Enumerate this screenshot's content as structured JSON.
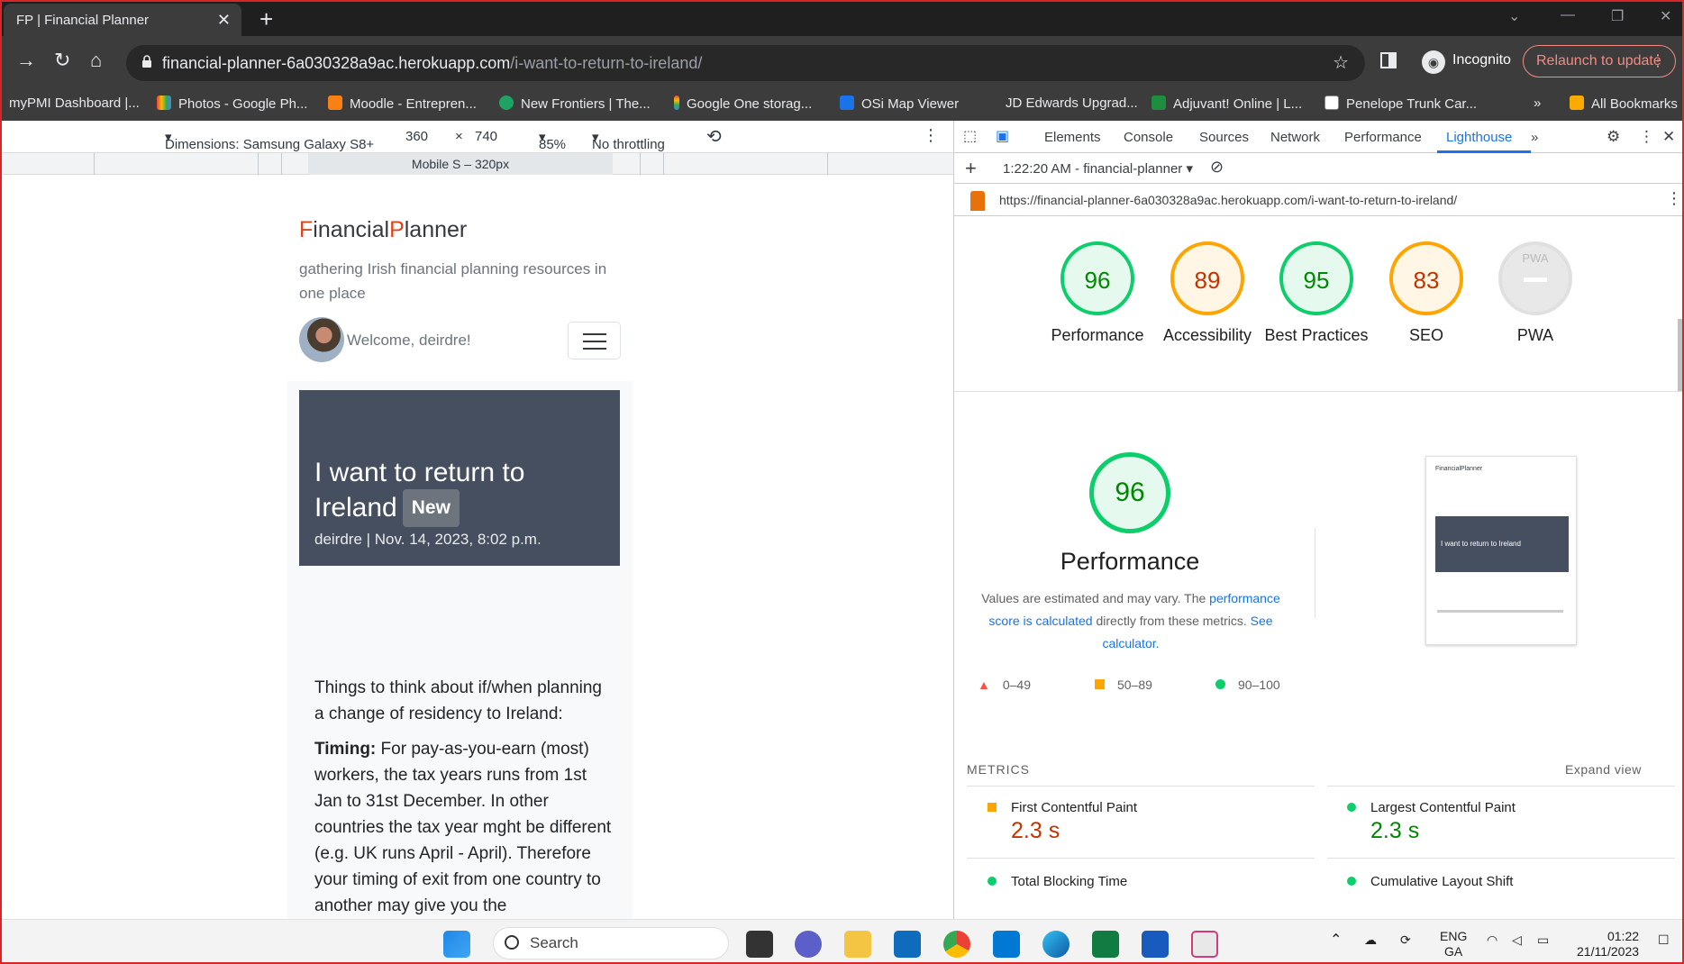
{
  "browser": {
    "tab_title": "FP | Financial Planner",
    "url_host": "financial-planner-6a030328a9ac.herokuapp.com",
    "url_path": "/i-want-to-return-to-ireland/",
    "incognito_label": "Incognito",
    "relaunch_label": "Relaunch to update",
    "bookmarks": [
      "myPMI Dashboard |...",
      "Photos - Google Ph...",
      "Moodle - Entrepren...",
      "New Frontiers | The...",
      "Google One storag...",
      "OSi Map Viewer",
      "JD Edwards Upgrad...",
      "Adjuvant! Online | L...",
      "Penelope Trunk Car..."
    ],
    "all_bookmarks": "All Bookmarks",
    "more_bookmarks": "»"
  },
  "device_toolbar": {
    "dimensions": "Dimensions: Samsung Galaxy S8+",
    "width": "360",
    "times": "×",
    "height": "740",
    "zoom": "85%",
    "throttle": "No throttling",
    "media_query": "Mobile S – 320px"
  },
  "site": {
    "brand_f": "F",
    "brand_inancial": "inancial",
    "brand_p": "P",
    "brand_lanner": "lanner",
    "tagline": "gathering Irish financial planning resources in one place",
    "welcome": "Welcome, deirdre!",
    "post_title": "I want to return to Ireland",
    "badge": "New",
    "post_meta": "deirdre | Nov. 14, 2023, 8:02 p.m.",
    "para1": "Things to think about if/when planning a change of residency to Ireland:",
    "para2_bold": "Timing:",
    "para2": " For pay-as-you-earn (most) workers, the tax years runs from 1st Jan to 31st December.  In other countries the tax year mght be different (e.g. UK runs April - April). Therefore your timing of exit from one country to another may give you the"
  },
  "devtools": {
    "tabs": [
      "Elements",
      "Console",
      "Sources",
      "Network",
      "Performance",
      "Lighthouse"
    ],
    "more_tabs": "»",
    "report_time": "1:22:20 AM - financial-planner",
    "report_url": "https://financial-planner-6a030328a9ac.herokuapp.com/i-want-to-return-to-ireland/",
    "scores": [
      {
        "value": "96",
        "label": "Performance",
        "status": "green"
      },
      {
        "value": "89",
        "label": "Accessibility",
        "status": "orange"
      },
      {
        "value": "95",
        "label": "Best Practices",
        "status": "green"
      },
      {
        "value": "83",
        "label": "SEO",
        "status": "orange"
      },
      {
        "value": "PWA",
        "label": "PWA",
        "status": "grey"
      }
    ],
    "perf_score": "96",
    "perf_title": "Performance",
    "desc_prefix": "Values are estimated and may vary. The ",
    "desc_link1": "performance score is calculated",
    "desc_mid": " directly from these metrics. ",
    "desc_link2": "See calculator.",
    "legend": [
      "0–49",
      "50–89",
      "90–100"
    ],
    "thumb_brand": "FinancialPlanner",
    "thumb_title": "I want to return to Ireland",
    "metrics_header": "METRICS",
    "expand_view": "Expand view",
    "metrics": [
      {
        "name": "First Contentful Paint",
        "value": "2.3 s",
        "status": "orange"
      },
      {
        "name": "Largest Contentful Paint",
        "value": "2.3 s",
        "status": "green"
      },
      {
        "name": "Total Blocking Time",
        "value": "",
        "status": "green"
      },
      {
        "name": "Cumulative Layout Shift",
        "value": "",
        "status": "green"
      }
    ]
  },
  "taskbar": {
    "search": "Search",
    "lang": "ENG",
    "lang2": "GA",
    "time": "01:22",
    "date": "21/11/2023"
  },
  "colors": {
    "brand_accent": "#d9451c",
    "hero_bg": "#454f5f",
    "lh_green": "#0cce6b",
    "lh_orange": "#ffa400",
    "lh_red": "#ff4e42",
    "devtools_blue": "#1a73e8"
  }
}
